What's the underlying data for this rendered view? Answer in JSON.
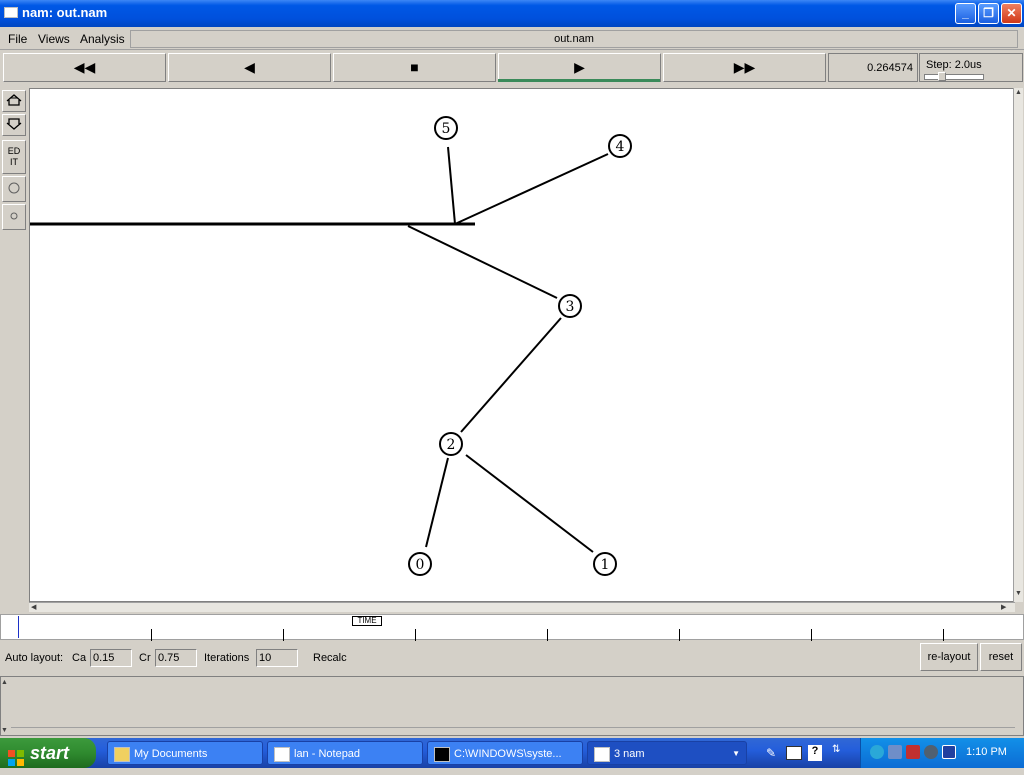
{
  "window": {
    "title": "nam: out.nam"
  },
  "menu": {
    "file": "File",
    "views": "Views",
    "analysis": "Analysis",
    "filename": "out.nam"
  },
  "controls": {
    "rewind": "◀◀",
    "back": "◀",
    "stop": "■",
    "play": "▶",
    "ffwd": "▶▶",
    "time": "0.264574",
    "step": "Step: 2.0us"
  },
  "left_toolbar": {
    "edit_label": "EDIT"
  },
  "topology": {
    "nodes": [
      {
        "id": "0",
        "label": "0"
      },
      {
        "id": "1",
        "label": "1"
      },
      {
        "id": "2",
        "label": "2"
      },
      {
        "id": "3",
        "label": "3"
      },
      {
        "id": "4",
        "label": "4"
      },
      {
        "id": "5",
        "label": "5"
      }
    ],
    "links": [
      [
        "0",
        "2"
      ],
      [
        "1",
        "2"
      ],
      [
        "2",
        "3"
      ],
      [
        "3",
        "lan"
      ],
      [
        "4",
        "lan"
      ],
      [
        "5",
        "lan"
      ]
    ]
  },
  "timeline": {
    "label": "TIME"
  },
  "auto_layout": {
    "label": "Auto layout:",
    "ca_label": "Ca",
    "ca_value": "0.15",
    "cr_label": "Cr",
    "cr_value": "0.75",
    "iterations_label": "Iterations",
    "iterations_value": "10",
    "recalc": "Recalc",
    "relayout": "re-layout",
    "reset": "reset"
  },
  "taskbar": {
    "start": "start",
    "tasks": [
      "My Documents",
      "lan - Notepad",
      "C:\\WINDOWS\\syste...",
      "3 nam"
    ],
    "clock": "1:10 PM"
  }
}
